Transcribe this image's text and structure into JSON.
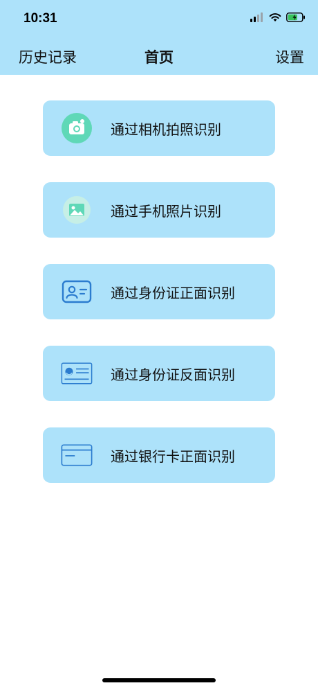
{
  "status_bar": {
    "time": "10:31"
  },
  "nav": {
    "left_label": "历史记录",
    "title": "首页",
    "right_label": "设置"
  },
  "cards": [
    {
      "label": "通过相机拍照识别",
      "icon": "camera-icon"
    },
    {
      "label": "通过手机照片识别",
      "icon": "photo-icon"
    },
    {
      "label": "通过身份证正面识别",
      "icon": "id-card-front-icon"
    },
    {
      "label": "通过身份证反面识别",
      "icon": "id-card-back-icon"
    },
    {
      "label": "通过银行卡正面识别",
      "icon": "bank-card-icon"
    }
  ],
  "colors": {
    "header_bg": "#ade2fa",
    "card_bg": "#ade2fa",
    "icon_green": "#5fd8b7",
    "icon_blue": "#2b7ccf"
  }
}
